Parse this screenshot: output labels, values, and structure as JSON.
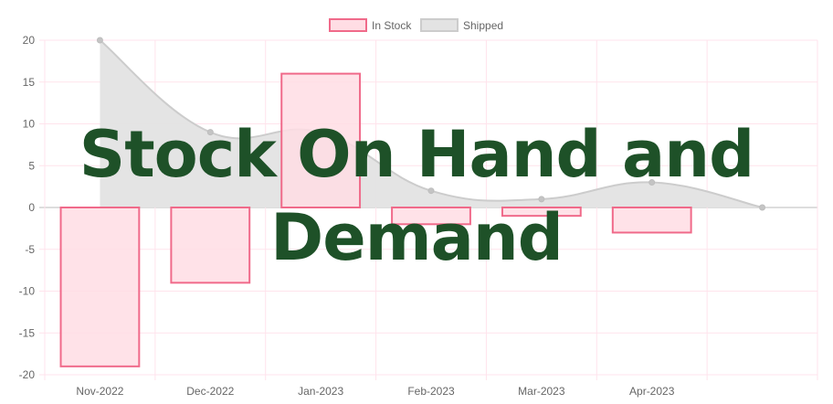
{
  "chart_data": {
    "type": "bar",
    "categories": [
      "Nov-2022",
      "Dec-2022",
      "Jan-2023",
      "Feb-2023",
      "Mar-2023",
      "Apr-2023",
      ""
    ],
    "series": [
      {
        "name": "In Stock",
        "type": "bar",
        "values": [
          -19,
          -9,
          16,
          -2,
          -1,
          -3,
          null
        ],
        "fill": "#ffdde4",
        "stroke": "#f06a8a"
      },
      {
        "name": "Shipped",
        "type": "area",
        "values": [
          20,
          9,
          9,
          2,
          1,
          3,
          0
        ],
        "fill": "#e3e3e3",
        "stroke": "#cccccc"
      }
    ],
    "y_ticks": [
      "20",
      "15",
      "10",
      "5",
      "0",
      "-5",
      "-10",
      "-15",
      "-20"
    ],
    "ylim": [
      -20,
      20
    ],
    "grid": true,
    "grid_color": "#ffe3ec",
    "legend_position": "top-center",
    "title": ""
  },
  "overlay": {
    "line1": "Stock On Hand and",
    "line2": "Demand",
    "color": "#1e5128"
  }
}
